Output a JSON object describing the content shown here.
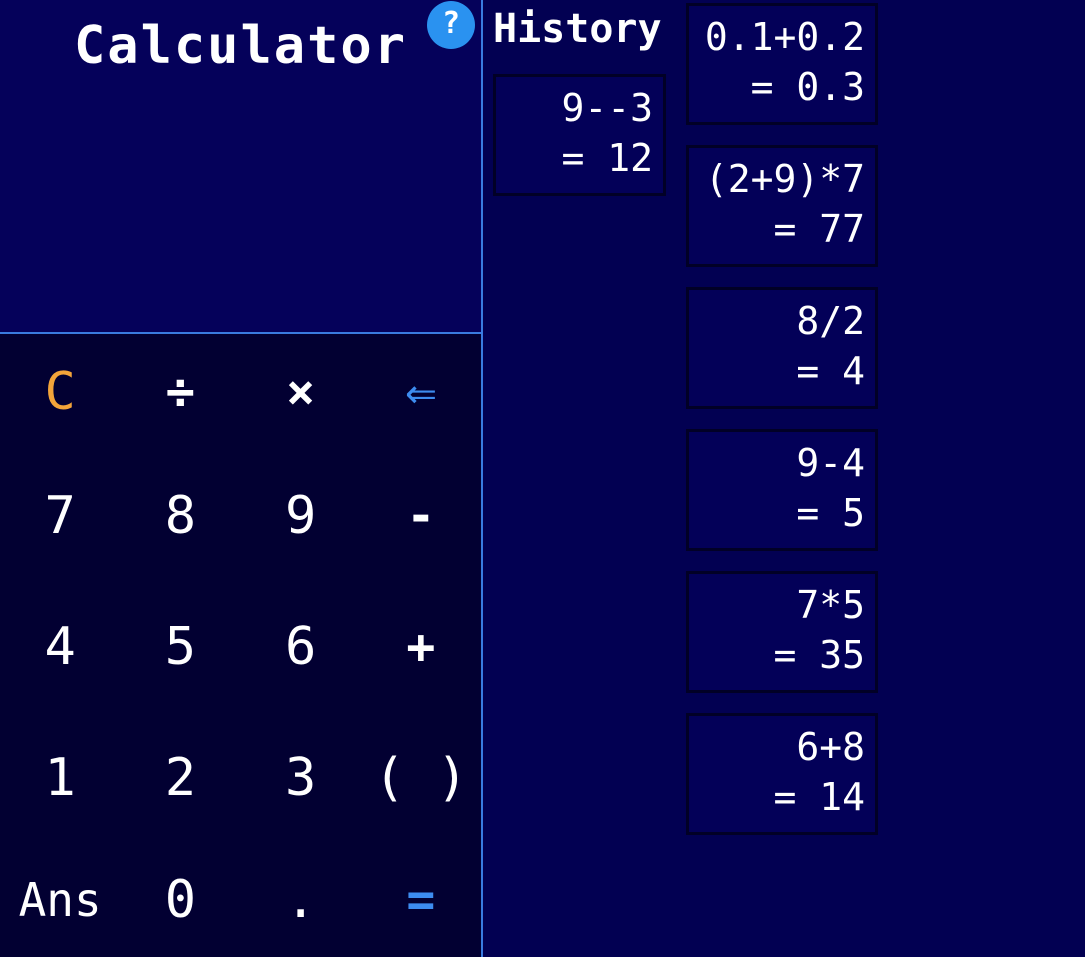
{
  "calculator": {
    "title": "Calculator",
    "help_label": "?",
    "keys": [
      {
        "label": "C",
        "name": "clear-button",
        "cls": "clear"
      },
      {
        "label": "÷",
        "name": "divide-button",
        "cls": "op"
      },
      {
        "label": "×",
        "name": "multiply-button",
        "cls": "op"
      },
      {
        "label": "⇐",
        "name": "backspace-button",
        "cls": "blue"
      },
      {
        "label": "7",
        "name": "digit-7-button",
        "cls": ""
      },
      {
        "label": "8",
        "name": "digit-8-button",
        "cls": ""
      },
      {
        "label": "9",
        "name": "digit-9-button",
        "cls": ""
      },
      {
        "label": "-",
        "name": "subtract-button",
        "cls": "op"
      },
      {
        "label": "4",
        "name": "digit-4-button",
        "cls": ""
      },
      {
        "label": "5",
        "name": "digit-5-button",
        "cls": ""
      },
      {
        "label": "6",
        "name": "digit-6-button",
        "cls": ""
      },
      {
        "label": "+",
        "name": "add-button",
        "cls": "op"
      },
      {
        "label": "1",
        "name": "digit-1-button",
        "cls": ""
      },
      {
        "label": "2",
        "name": "digit-2-button",
        "cls": ""
      },
      {
        "label": "3",
        "name": "digit-3-button",
        "cls": ""
      },
      {
        "label": "( )",
        "name": "parentheses-button",
        "cls": ""
      },
      {
        "label": "Ans",
        "name": "ans-button",
        "cls": "small"
      },
      {
        "label": "0",
        "name": "digit-0-button",
        "cls": ""
      },
      {
        "label": ".",
        "name": "decimal-button",
        "cls": ""
      },
      {
        "label": "=",
        "name": "equals-button",
        "cls": "blue op"
      }
    ]
  },
  "history": {
    "title": "History",
    "entries": [
      {
        "expression": "9--3",
        "result": "= 12"
      },
      {
        "expression": "0.1+0.2",
        "result": "= 0.3"
      },
      {
        "expression": "(2+9)*7",
        "result": "= 77"
      },
      {
        "expression": "8/2",
        "result": "= 4"
      },
      {
        "expression": "9-4",
        "result": "= 5"
      },
      {
        "expression": "7*5",
        "result": "= 35"
      },
      {
        "expression": "6+8",
        "result": "= 14"
      }
    ]
  },
  "colors": {
    "background": "#020052",
    "accent_blue": "#3d8cf0",
    "clear_orange": "#f3a43a",
    "help_blue": "#2a92f0"
  }
}
